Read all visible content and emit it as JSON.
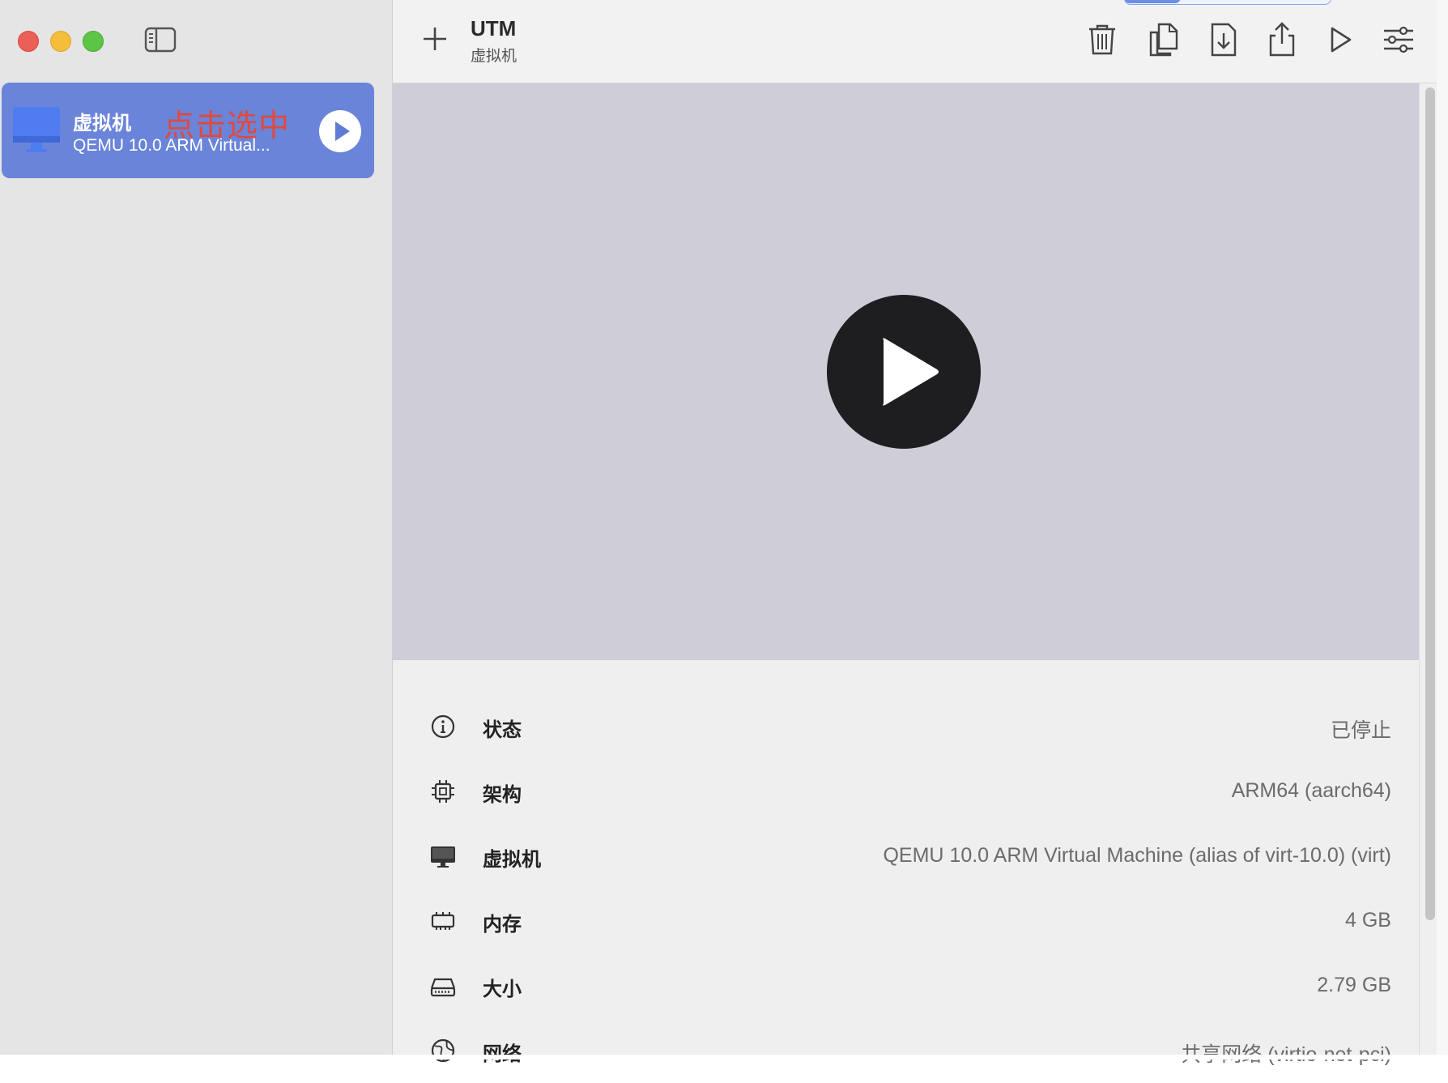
{
  "window": {
    "title": "UTM",
    "subtitle": "虚拟机"
  },
  "sidebar": {
    "vm": {
      "name": "虚拟机",
      "annotation": "点击选中",
      "description": "QEMU 10.0 ARM Virtual..."
    }
  },
  "toolbar": {
    "buttons": [
      "add-icon",
      "trash-icon",
      "clone-icon",
      "download-icon",
      "share-icon",
      "play-icon",
      "settings-icon"
    ]
  },
  "info": {
    "rows": [
      {
        "label": "状态",
        "value": "已停止",
        "icon": "info-circle-icon"
      },
      {
        "label": "架构",
        "value": "ARM64 (aarch64)",
        "icon": "cpu-icon"
      },
      {
        "label": "虚拟机",
        "value": "QEMU 10.0 ARM Virtual Machine (alias of virt-10.0) (virt)",
        "icon": "monitor-icon"
      },
      {
        "label": "内存",
        "value": "4 GB",
        "icon": "memory-icon"
      },
      {
        "label": "大小",
        "value": "2.79 GB",
        "icon": "drive-icon"
      },
      {
        "label": "网络",
        "value": "共享网络 (virtio-net-pci)",
        "icon": "globe-icon"
      }
    ]
  },
  "colors": {
    "selection": "#6a84d9",
    "preview_bg": "#cecdd8",
    "annotation": "#e0493d"
  }
}
